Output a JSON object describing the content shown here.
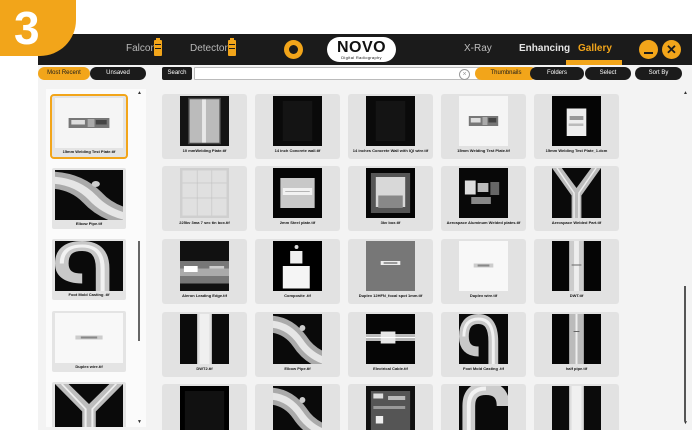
{
  "step_number": "3",
  "topbar": {
    "device_1": "Falcon",
    "device_2": "Detector",
    "logo_title": "NOVO",
    "logo_subtitle": "Digital Radiography",
    "nav": [
      "X-Ray",
      "Enhancing",
      "Gallery"
    ],
    "active_nav": "Gallery"
  },
  "filters": {
    "most_recent": "Most Recent",
    "unsaved": "Unsaved",
    "search_label": "Search",
    "search_value": "",
    "thumbnails": "Thumbnails",
    "folders": "Folders",
    "select": "Select",
    "sort_by": "Sort By"
  },
  "sidebar_items": [
    {
      "label": "15mm Welding Test Plate.tif",
      "image": "plate",
      "selected": true
    },
    {
      "label": "Elbow Pipe.tif",
      "image": "elbow"
    },
    {
      "label": "Foot Mold Casting .tif",
      "image": "hook"
    },
    {
      "label": "Duplex wire.tif",
      "image": "wire"
    },
    {
      "label": "",
      "image": "tee"
    }
  ],
  "gallery": [
    {
      "label": "10 mmWelding Plate.tif",
      "image": "weldplate"
    },
    {
      "label": "14 inch Concrete wall.tif",
      "image": "dark"
    },
    {
      "label": "14 inches Concrete Wall with IQI wire.tif",
      "image": "dark"
    },
    {
      "label": "15mm Welding Test Plate.tif",
      "image": "plate"
    },
    {
      "label": "15mm Welding Test Plate_1.dcm",
      "image": "plate_dark"
    },
    {
      "label": "225kv 3ma 7 sec tin box.tif",
      "image": "tinbox"
    },
    {
      "label": "2mm Steel plate.tif",
      "image": "steel"
    },
    {
      "label": "3kv box.tif",
      "image": "glow"
    },
    {
      "label": "Aerospace Aluminum Welded plates.tif",
      "image": "plates"
    },
    {
      "label": "Aerospace Welded Part.tif",
      "image": "tee"
    },
    {
      "label": "Aleron Leading Edge.tif",
      "image": "aleron"
    },
    {
      "label": "Composite .tif",
      "image": "composite"
    },
    {
      "label": "Duplex 12HFN_focal spot 1mm.tif",
      "image": "duplex_focal"
    },
    {
      "label": "Duplex wire.tif",
      "image": "wire"
    },
    {
      "label": "DWT.tif",
      "image": "dwt"
    },
    {
      "label": "DWT2.tif",
      "image": "bar"
    },
    {
      "label": "Elbow Pipe.tif",
      "image": "elbow"
    },
    {
      "label": "Electrical Cable.tif",
      "image": "cable"
    },
    {
      "label": "Foot Mold Casting .tif",
      "image": "hook"
    },
    {
      "label": "half pipe.tif",
      "image": "halfpipe"
    },
    {
      "label": "",
      "image": "dark_partial"
    },
    {
      "label": "",
      "image": "elbow"
    },
    {
      "label": "",
      "image": "circuit"
    },
    {
      "label": "",
      "image": "tube"
    },
    {
      "label": "",
      "image": "bar"
    }
  ],
  "colors": {
    "accent": "#f2a51a",
    "topbar": "#1b1b1b",
    "background": "#f3f3f3"
  }
}
